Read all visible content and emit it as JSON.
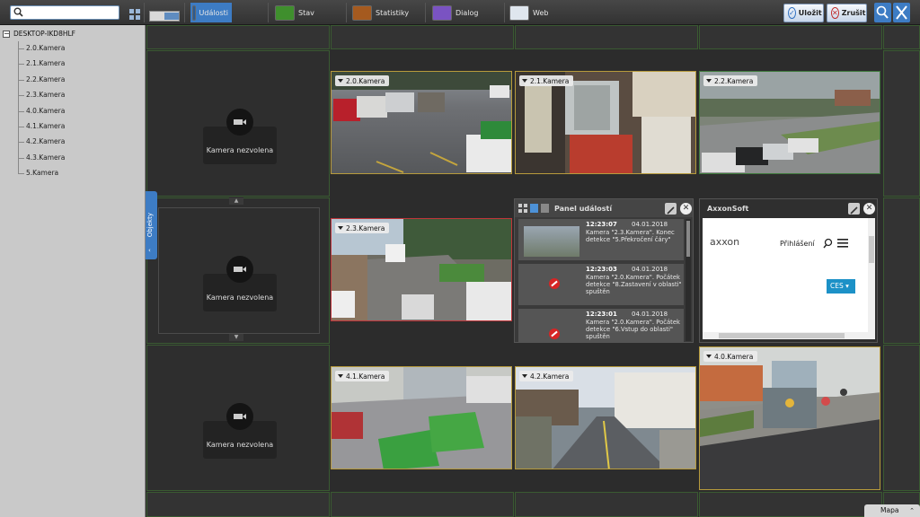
{
  "toolbar": {
    "search_placeholder": "",
    "buttons": [
      {
        "label": "Události",
        "icon": "events-icon"
      },
      {
        "label": "Stav",
        "icon": "status-icon"
      },
      {
        "label": "Statistiky",
        "icon": "statistics-icon"
      },
      {
        "label": "Dialog",
        "icon": "dialog-icon"
      },
      {
        "label": "Web",
        "icon": "web-icon"
      }
    ],
    "save_label": "Uložit",
    "cancel_label": "Zrušit"
  },
  "sidebar": {
    "root": "DESKTOP-IKD8HLF",
    "items": [
      "2.0.Kamera",
      "2.1.Kamera",
      "2.2.Kamera",
      "2.3.Kamera",
      "4.0.Kamera",
      "4.1.Kamera",
      "4.2.Kamera",
      "4.3.Kamera",
      "5.Kamera"
    ],
    "tab_label": "Objekty"
  },
  "cells": {
    "empty_label": "Kamera nezvolena",
    "cam_20": "2.0.Kamera",
    "cam_21": "2.1.Kamera",
    "cam_22": "2.2.Kamera",
    "cam_23": "2.3.Kamera",
    "cam_40": "4.0.Kamera",
    "cam_41": "4.1.Kamera",
    "cam_42": "4.2.Kamera"
  },
  "event_panel": {
    "title": "Panel událostí",
    "events": [
      {
        "time": "12:23:07",
        "date": "04.01.2018",
        "text": "Kamera \"2.3.Kamera\". Konec detekce \"5.Překročení čáry\""
      },
      {
        "time": "12:23:03",
        "date": "04.01.2018",
        "text": "Kamera \"2.0.Kamera\". Počátek detekce \"8.Zastavení v oblasti\" spuštěn"
      },
      {
        "time": "12:23:01",
        "date": "04.01.2018",
        "text": "Kamera \"2.0.Kamera\". Počátek detekce \"6.Vstup do oblasti\" spuštěn"
      }
    ]
  },
  "web_panel": {
    "title": "AxxonSoft",
    "logo": "axxon",
    "login": "Přihlášení",
    "lang": "CES"
  },
  "map_tab": "Mapa",
  "colors": {
    "accent": "#3d7cc4",
    "cell_yellow": "#b79b3c",
    "cell_red": "#c0353a",
    "cell_green": "#3e7a3b"
  }
}
